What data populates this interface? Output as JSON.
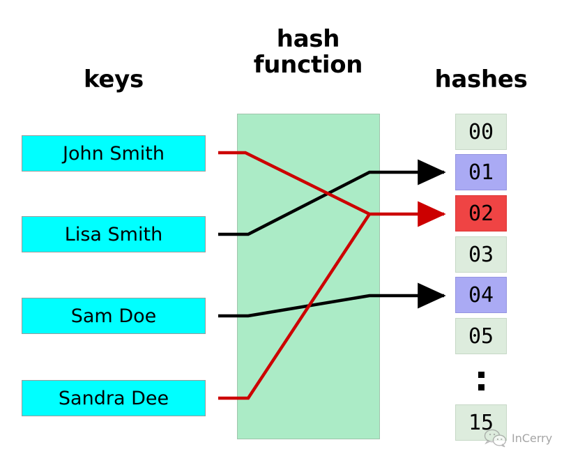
{
  "headings": {
    "keys": "keys",
    "hash_function": "hash\nfunction",
    "hashes": "hashes"
  },
  "keys": [
    {
      "label": "John Smith"
    },
    {
      "label": "Lisa Smith"
    },
    {
      "label": "Sam Doe"
    },
    {
      "label": "Sandra Dee"
    }
  ],
  "buckets": [
    {
      "label": "00",
      "state": "empty"
    },
    {
      "label": "01",
      "state": "filled"
    },
    {
      "label": "02",
      "state": "collision"
    },
    {
      "label": "03",
      "state": "empty"
    },
    {
      "label": "04",
      "state": "filled"
    },
    {
      "label": "05",
      "state": "empty"
    },
    {
      "label": "15",
      "state": "empty"
    }
  ],
  "ellipsis": "⋮",
  "colors": {
    "key_box": "#00ffff",
    "hash_panel": "#abebc6",
    "bucket_empty": "#ddecdd",
    "bucket_filled": "#aaaaf4",
    "bucket_collision": "#ef4444",
    "wire_black": "#000000",
    "wire_red": "#cc0000"
  },
  "watermark": {
    "label": "InCerry",
    "icon": "wechat-icon"
  }
}
